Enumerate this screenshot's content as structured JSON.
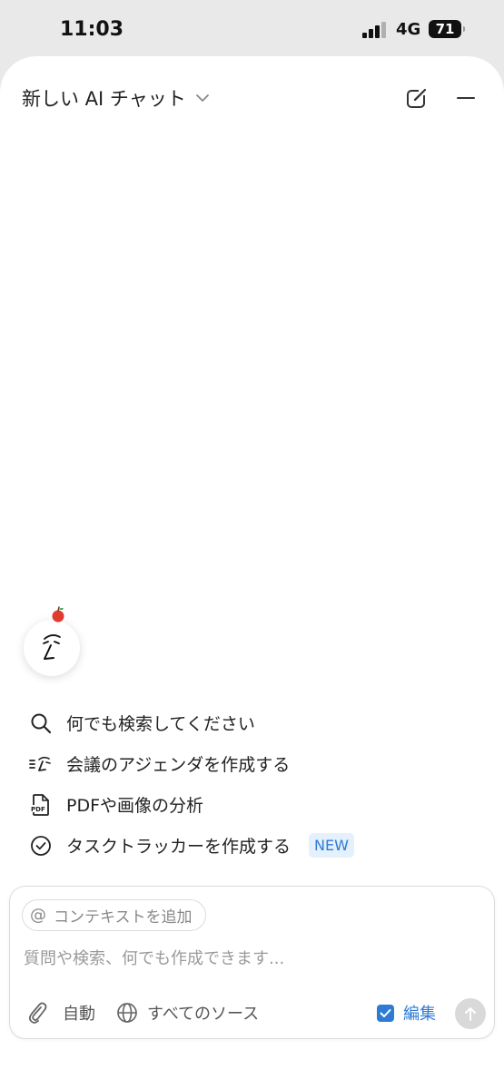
{
  "status": {
    "time": "11:03",
    "network": "4G",
    "battery": "71"
  },
  "header": {
    "title": "新しい AI チャット"
  },
  "suggestions": [
    {
      "label": "何でも検索してください",
      "icon": "search-icon"
    },
    {
      "label": "会議のアジェンダを作成する",
      "icon": "agenda-icon"
    },
    {
      "label": "PDFや画像の分析",
      "icon": "pdf-icon"
    },
    {
      "label": "タスクトラッカーを作成する",
      "icon": "check-circle-icon"
    }
  ],
  "new_badge": "NEW",
  "composer": {
    "context_at": "@",
    "context_label": "コンテキストを追加",
    "placeholder": "質問や検索、何でも作成できます...",
    "mode": "自動",
    "sources": "すべてのソース",
    "edit": "編集"
  },
  "colors": {
    "accent": "#2f7bd4",
    "badge_bg": "#e4f0fb",
    "send_disabled": "#d9d9d9"
  }
}
